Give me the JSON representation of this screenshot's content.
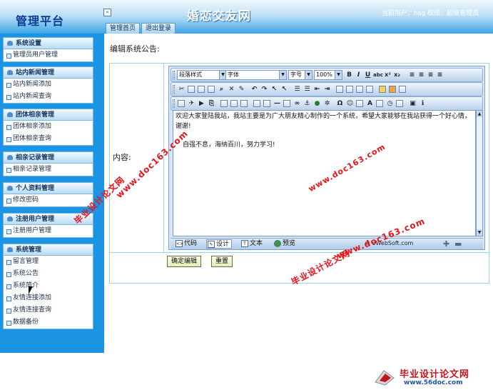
{
  "header": {
    "logo": "管理平台",
    "collapse_icon": "«",
    "site_title": "婚恋交友网",
    "user_info": "当前用户：hsg  权限：超级管理员",
    "tabs": [
      "管理首页",
      "退出登录"
    ]
  },
  "sidebar": {
    "groups": [
      {
        "title": "系统设置",
        "items": [
          "管理员用户管理"
        ]
      },
      {
        "title": "站内新闻管理",
        "items": [
          "站内新闻添加",
          "站内新闻查询"
        ]
      },
      {
        "title": "团体相亲管理",
        "items": [
          "团体相亲添加",
          "团体相亲查询"
        ]
      },
      {
        "title": "相亲记录管理",
        "items": [
          "相亲记录管理"
        ]
      },
      {
        "title": "个人资料管理",
        "items": [
          "修改密码"
        ]
      },
      {
        "title": "注册用户管理",
        "items": [
          "注册用户管理"
        ]
      },
      {
        "title": "系统管理",
        "items": [
          "留言管理",
          "系统公告",
          "系统简介",
          "友情连接添加",
          "友情连接查询",
          "数据备份"
        ]
      }
    ]
  },
  "main": {
    "title": "编辑系统公告:",
    "content_label": "内容:",
    "submit_label": "确定编辑",
    "reset_label": "重置"
  },
  "editor": {
    "paragraph_style": "段落样式",
    "font_family": "字体",
    "font_size": "字号",
    "zoom": "100%",
    "content_line1": "欢迎大家登陆我站，我站主要是为广大朋友精心制作的一个系统，希望大家能够在我站获得一个好心情，谢谢!",
    "content_line2": "自强不息，海纳百川，努力学习!",
    "modes": [
      "代码",
      "设计",
      "文本",
      "预览"
    ],
    "active_mode": "设计",
    "credit": "© eWebSoft.com",
    "toolbar_icons": [
      "cut-icon",
      "copy-icon",
      "paste-icon",
      "find-icon",
      "undo-icon",
      "redo-icon",
      "image-icon",
      "table-icon",
      "link-icon",
      "smiley-icon"
    ]
  },
  "watermarks": {
    "cn": "毕业设计论文网",
    "url": "www.doc163.com"
  },
  "footer_logo": {
    "title": "毕业设计论文网",
    "url": "www.56doc.com"
  },
  "colors": {
    "sidebar_bg": "#1a94e3",
    "header_accent": "#3da6e6",
    "watermark": "#e8141a"
  }
}
